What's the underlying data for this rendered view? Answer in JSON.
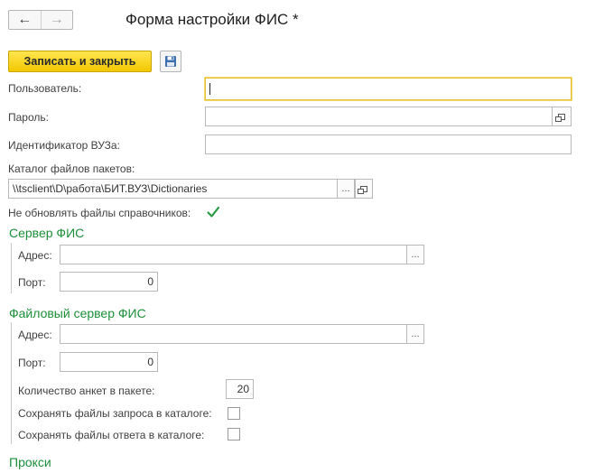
{
  "window": {
    "title": "Форма настройки ФИС *",
    "nav": {
      "back_icon": "←",
      "forward_icon": "→"
    }
  },
  "toolbar": {
    "save_close_label": "Записать и закрыть",
    "save_icon": "floppy-disk-icon"
  },
  "fields": {
    "user": {
      "label": "Пользователь:",
      "value": ""
    },
    "password": {
      "label": "Пароль:",
      "value": ""
    },
    "university_id": {
      "label": "Идентификатор ВУЗа:",
      "value": ""
    },
    "packages_dir": {
      "label": "Каталог файлов пакетов:",
      "value": "\\\\tsclient\\D\\работа\\БИТ.ВУЗ\\Dictionaries"
    },
    "no_update_dicts": {
      "label": "Не обновлять файлы справочников:",
      "checked": true
    }
  },
  "fis_server": {
    "title": "Сервер ФИС",
    "address": {
      "label": "Адрес:",
      "value": ""
    },
    "port": {
      "label": "Порт:",
      "value": "0"
    }
  },
  "fis_file_server": {
    "title": "Файловый сервер ФИС",
    "address": {
      "label": "Адрес:",
      "value": ""
    },
    "port": {
      "label": "Порт:",
      "value": "0"
    },
    "batch_count": {
      "label": "Количество анкет в пакете:",
      "value": "20"
    },
    "save_requests": {
      "label": "Сохранять файлы запроса в каталоге:",
      "checked": false
    },
    "save_responses": {
      "label": "Сохранять файлы ответа в каталоге:",
      "checked": false
    }
  },
  "proxy": {
    "title": "Прокси"
  },
  "buttons": {
    "ellipsis": "..."
  },
  "colors": {
    "accent_yellow": "#f3c800",
    "section_green": "#1d8f3a",
    "focus_border": "#e6bf36"
  }
}
